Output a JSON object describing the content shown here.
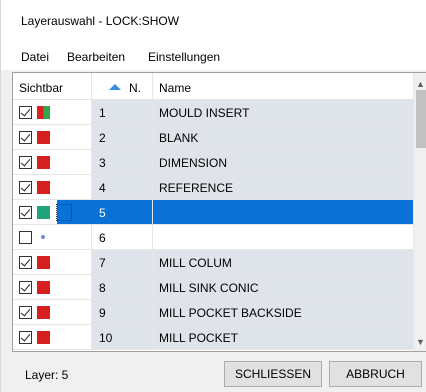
{
  "window": {
    "title": "Layerauswahl - LOCK:SHOW"
  },
  "menu": {
    "items": [
      "Datei",
      "Bearbeiten",
      "Einstellungen"
    ]
  },
  "table": {
    "columns": {
      "visible": "Sichtbar",
      "number": "N.",
      "name": "Name"
    },
    "sort": {
      "column": "number",
      "direction": "ascending"
    },
    "selected_number": "5",
    "rows": [
      {
        "checked": true,
        "swatch": "split",
        "color": "#e02020",
        "color2": "#2ea84a",
        "number": "1",
        "name": "MOULD INSERT"
      },
      {
        "checked": true,
        "swatch": "solid",
        "color": "#d61f1f",
        "number": "2",
        "name": "BLANK"
      },
      {
        "checked": true,
        "swatch": "solid",
        "color": "#d61f1f",
        "number": "3",
        "name": "DIMENSION"
      },
      {
        "checked": true,
        "swatch": "solid",
        "color": "#d61f1f",
        "number": "4",
        "name": "REFERENCE"
      },
      {
        "checked": true,
        "swatch": "solid",
        "color": "#1fa37a",
        "number": "5",
        "name": ""
      },
      {
        "checked": false,
        "swatch": "dot",
        "color": "#6f8fc8",
        "number": "6",
        "name": ""
      },
      {
        "checked": true,
        "swatch": "solid",
        "color": "#d61f1f",
        "number": "7",
        "name": "MILL COLUM"
      },
      {
        "checked": true,
        "swatch": "solid",
        "color": "#d61f1f",
        "number": "8",
        "name": "MILL SINK CONIC"
      },
      {
        "checked": true,
        "swatch": "solid",
        "color": "#d61f1f",
        "number": "9",
        "name": "MILL POCKET BACKSIDE"
      },
      {
        "checked": true,
        "swatch": "solid",
        "color": "#d61f1f",
        "number": "10",
        "name": "MILL POCKET"
      }
    ]
  },
  "status": {
    "text": "Layer: 5"
  },
  "buttons": {
    "close": "SCHLIESSEN",
    "cancel": "ABBRUCH"
  },
  "colors": {
    "selection": "#0a72d6",
    "row_shade": "#dfe3ea",
    "sort_arrow": "#3a8de0"
  }
}
